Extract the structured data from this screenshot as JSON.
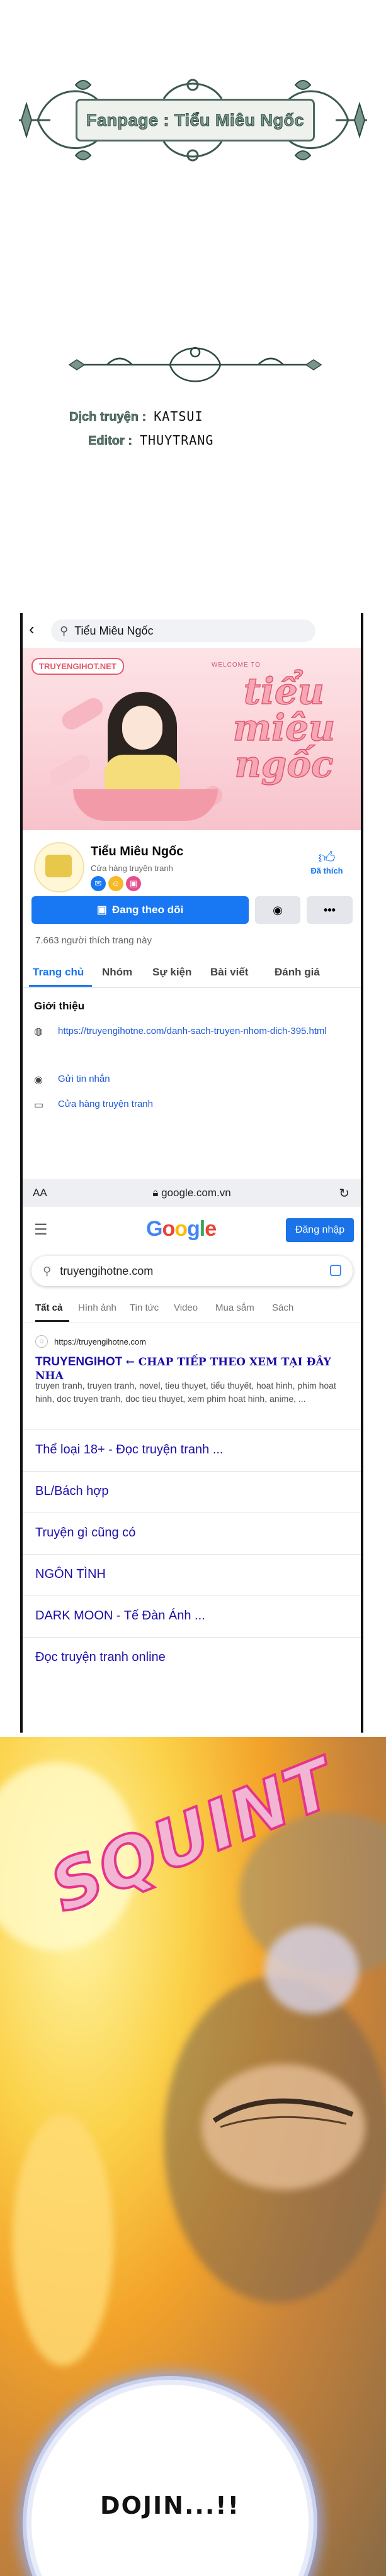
{
  "fanpage": {
    "label": "Fanpage : Tiểu Miêu Ngốc"
  },
  "credits": {
    "translate_key": "Dịch truyện :",
    "translate_val": "KATSUI",
    "editor_key": "Editor :",
    "editor_val": "THUYTRANG"
  },
  "facebook": {
    "search_text": "Tiểu Miêu Ngốc",
    "cover_logo": "TRUYENGIHOT.NET",
    "cover_welcome": "WELCOME TO",
    "cover_title": "tiểu miêu ngốc",
    "page_name": "Tiểu Miêu Ngốc",
    "page_category": "Cửa hàng truyện tranh",
    "liked_label": "Đã thích",
    "follow_label": "Đang theo dõi",
    "likes_count": "7.663 người thích trang này",
    "tabs": [
      "Trang chủ",
      "Nhóm",
      "Sự kiện",
      "Bài viết",
      "Đánh giá"
    ],
    "intro_heading": "Giới thiệu",
    "intro_link": "https://truyengihotne.com/danh-sach-truyen-nhom-dich-395.html",
    "intro_message": "Gửi tin nhắn",
    "intro_shop": "Cửa hàng truyện tranh"
  },
  "browser": {
    "aa": "AA",
    "url": "google.com.vn"
  },
  "google": {
    "logo": "Google",
    "signin": "Đăng nhập",
    "query": "truyengihotne.com",
    "tabs": [
      "Tất cả",
      "Hình ảnh",
      "Tin tức",
      "Video",
      "Mua sắm",
      "Sách"
    ],
    "result_site": "https://truyengihotne.com",
    "result_title": "TRUYENGIHOT",
    "result_title_suffix": "← CHAP TIẾP THEO XEM TẠI ĐÂY NHA",
    "result_snippet": "truyen tranh, truyen tranh, novel, tieu thuyet, tiểu thuyết, hoat hinh, phim hoat hinh, doc truyen tranh, doc tieu thuyet, xem phim hoat hinh, anime, ...",
    "links": [
      "Thể loại 18+ - Đọc truyện tranh ...",
      "BL/Bách hợp",
      "Truyện gì cũng có",
      "NGÔN TÌNH",
      "DARK MOON - Tế Đàn Ánh ...",
      "Đọc truyện tranh online"
    ]
  },
  "comic": {
    "sfx": "SQUINT",
    "speech": "DOJIN...!!"
  },
  "colors": {
    "fb_blue": "#1877f2",
    "google_link": "#1a0dab",
    "sfx_pink": "#e6338e"
  },
  "icons": [
    "back-arrow-icon",
    "search-icon",
    "messenger-icon",
    "more-icon",
    "thumbs-up-icon",
    "globe-icon",
    "reload-icon",
    "hamburger-icon",
    "google-lens-icon"
  ]
}
